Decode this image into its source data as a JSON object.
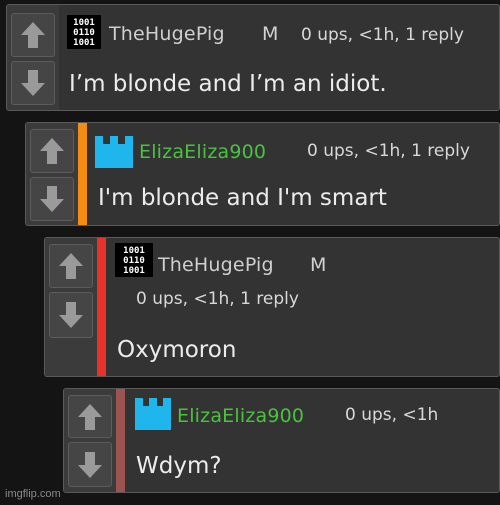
{
  "comments": [
    {
      "username": "TheHugePig",
      "badge": "M",
      "meta": "0 ups, <1h, 1 reply",
      "text": "I’m blonde and I’m an idiot.",
      "avatar": "binary-code-icon",
      "stripe_color": null
    },
    {
      "username": "ElizaEliza900",
      "badge": "",
      "meta": "0 ups, <1h, 1 reply",
      "text": "I'm blonde and I'm smart",
      "avatar": "cyan-castle-icon",
      "stripe_color": "#f28c12"
    },
    {
      "username": "TheHugePig",
      "badge": "M",
      "meta": "0 ups, <1h, 1 reply",
      "text": "Oxymoron",
      "avatar": "binary-code-icon",
      "stripe_color": "#e8322a"
    },
    {
      "username": "ElizaEliza900",
      "badge": "",
      "meta": "0 ups, <1h",
      "text": "Wdym?",
      "avatar": "cyan-castle-icon",
      "stripe_color": "#9b5450"
    }
  ],
  "colors": {
    "pig_username": "#cfcfcf",
    "eliza_username": "#4bc13f",
    "avatar_cyan": "#1fb6ee"
  },
  "watermark": "imgflip.com"
}
